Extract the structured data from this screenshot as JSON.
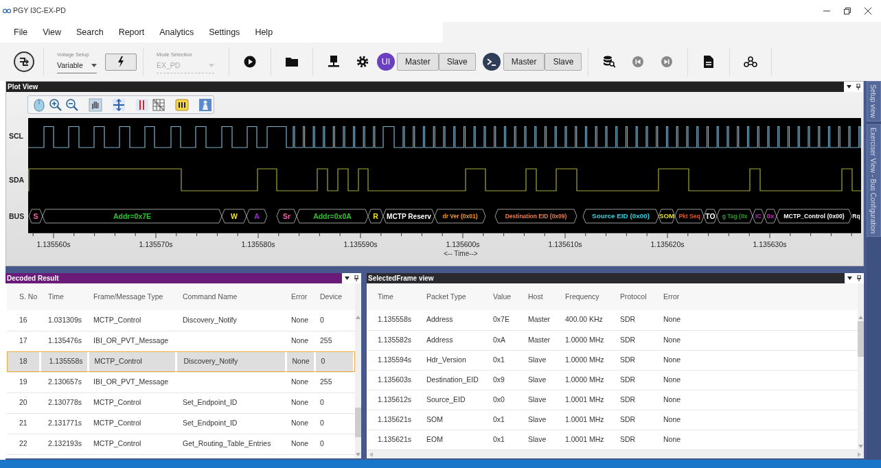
{
  "window": {
    "title": "PGY I3C-EX-PD"
  },
  "menu": [
    "File",
    "View",
    "Search",
    "Report",
    "Analytics",
    "Settings",
    "Help"
  ],
  "toolbar": {
    "voltage_setup": {
      "label": "Voltage Setup",
      "value": "Variable"
    },
    "mode_selection": {
      "label": "Mode Selection",
      "value": "EX_PD",
      "disabled": true
    },
    "user_badge": "UI",
    "host_groups": [
      {
        "buttons": [
          "Master",
          "Slave"
        ]
      },
      {
        "buttons": [
          "Master",
          "Slave"
        ]
      }
    ]
  },
  "plot_view": {
    "title": "Plot View",
    "signals": [
      "SCL",
      "SDA",
      "BUS"
    ],
    "bus_segments": [
      {
        "label": "S",
        "color": "#ff5fb0",
        "kind": "segment"
      },
      {
        "label": "Addr=0x7E",
        "color": "#2ec52e",
        "kind": "segment"
      },
      {
        "label": "W",
        "color": "#f0e030",
        "kind": "segment"
      },
      {
        "label": "A",
        "color": "#9b30d9",
        "kind": "segment"
      },
      {
        "label": "Sr",
        "color": "#ff5fb0",
        "kind": "segment"
      },
      {
        "label": "Addr=0x0A",
        "color": "#2ec52e",
        "kind": "segment"
      },
      {
        "label": "R",
        "color": "#f0e030",
        "kind": "segment"
      },
      {
        "label": "MCTP Reserv",
        "color": "#ffffff",
        "kind": "segment"
      },
      {
        "label": "dr Ver (0x01)",
        "color": "#f39c24",
        "kind": "segment"
      },
      {
        "label": "Destination EID (0x09)",
        "color": "#f07b50",
        "kind": "segment"
      },
      {
        "label": "Source EID (0x00)",
        "color": "#2fd4e0",
        "kind": "segment"
      },
      {
        "label": "SOM",
        "color": "#e8e020",
        "kind": "segment"
      },
      {
        "label": "Pkt Seq",
        "color": "#f05020",
        "kind": "segment"
      },
      {
        "label": "TO",
        "color": "#ffffff",
        "kind": "segment"
      },
      {
        "label": "g Tag (0x",
        "color": "#23a023",
        "kind": "segment"
      },
      {
        "label": "IC",
        "color": "#d020d0",
        "kind": "segment"
      },
      {
        "label": "0x",
        "color": "#d020d0",
        "kind": "segment"
      },
      {
        "label": "MCTP_Control (0x00)",
        "color": "#ffffff",
        "kind": "segment"
      },
      {
        "label": "Rq",
        "color": "#ffffff",
        "kind": "label"
      }
    ],
    "time_ticks": [
      "1.135560s",
      "1.135570s",
      "1.135580s",
      "1.135590s",
      "1.135600s",
      "1.135610s",
      "1.135620s",
      "1.135630s"
    ],
    "axis_title": "<-- Time-->"
  },
  "decoded_result": {
    "title": "Decoded Result",
    "columns": [
      "S. No",
      "Time",
      "Frame/Message Type",
      "Command Name",
      "Error",
      "Device"
    ],
    "rows": [
      {
        "no": "16",
        "time": "1.031309s",
        "type": "MCTP_Control",
        "command": "Discovery_Notify",
        "error": "None",
        "device": "0",
        "selected": false
      },
      {
        "no": "17",
        "time": "1.135476s",
        "type": "IBI_OR_PVT_Message",
        "error": "None",
        "device": "255",
        "selected": false
      },
      {
        "no": "18",
        "time": "1.135558s",
        "type": "MCTP_Control",
        "command": "Discovery_Notify",
        "error": "None",
        "device": "0",
        "selected": true
      },
      {
        "no": "19",
        "time": "2.130657s",
        "type": "IBI_OR_PVT_Message",
        "error": "None",
        "device": "255",
        "selected": false
      },
      {
        "no": "20",
        "time": "2.130778s",
        "type": "MCTP_Control",
        "command": "Set_Endpoint_ID",
        "error": "None",
        "device": "0",
        "selected": false
      },
      {
        "no": "21",
        "time": "2.131771s",
        "type": "MCTP_Control",
        "command": "Set_Endpoint_ID",
        "error": "None",
        "device": "0",
        "selected": false
      },
      {
        "no": "22",
        "time": "2.132193s",
        "type": "MCTP_Control",
        "command": "Get_Routing_Table_Entries",
        "error": "None",
        "device": "0",
        "selected": false
      }
    ]
  },
  "selected_frame": {
    "title": "SelectedFrame view",
    "columns": [
      "Time",
      "Packet Type",
      "Value",
      "Host",
      "Frequency",
      "Protocol",
      "Error"
    ],
    "rows": [
      {
        "time": "1.135558s",
        "packet_type": "Address",
        "value": "0x7E",
        "host": "Master",
        "frequency": "400.00 KHz",
        "protocol": "SDR",
        "error": "None"
      },
      {
        "time": "1.135582s",
        "packet_type": "Address",
        "value": "0xA",
        "host": "Master",
        "frequency": "1.0000 MHz",
        "protocol": "SDR",
        "error": "None"
      },
      {
        "time": "1.135594s",
        "packet_type": "Hdr_Version",
        "value": "0x1",
        "host": "Slave",
        "frequency": "1.0000 MHz",
        "protocol": "SDR",
        "error": "None"
      },
      {
        "time": "1.135603s",
        "packet_type": "Destination_EID",
        "value": "0x9",
        "host": "Slave",
        "frequency": "1.0000 MHz",
        "protocol": "SDR",
        "error": "None"
      },
      {
        "time": "1.135612s",
        "packet_type": "Source_EID",
        "value": "0x0",
        "host": "Slave",
        "frequency": "1.0001 MHz",
        "protocol": "SDR",
        "error": "None"
      },
      {
        "time": "1.135621s",
        "packet_type": "SOM",
        "value": "0x1",
        "host": "Slave",
        "frequency": "1.0001 MHz",
        "protocol": "SDR",
        "error": "None"
      },
      {
        "time": "1.135621s",
        "packet_type": "EOM",
        "value": "0x1",
        "host": "Slave",
        "frequency": "1.0001 MHz",
        "protocol": "SDR",
        "error": "None"
      }
    ]
  },
  "side_tabs": [
    "Setup view",
    "Exerciser View - Bus Configuration"
  ]
}
